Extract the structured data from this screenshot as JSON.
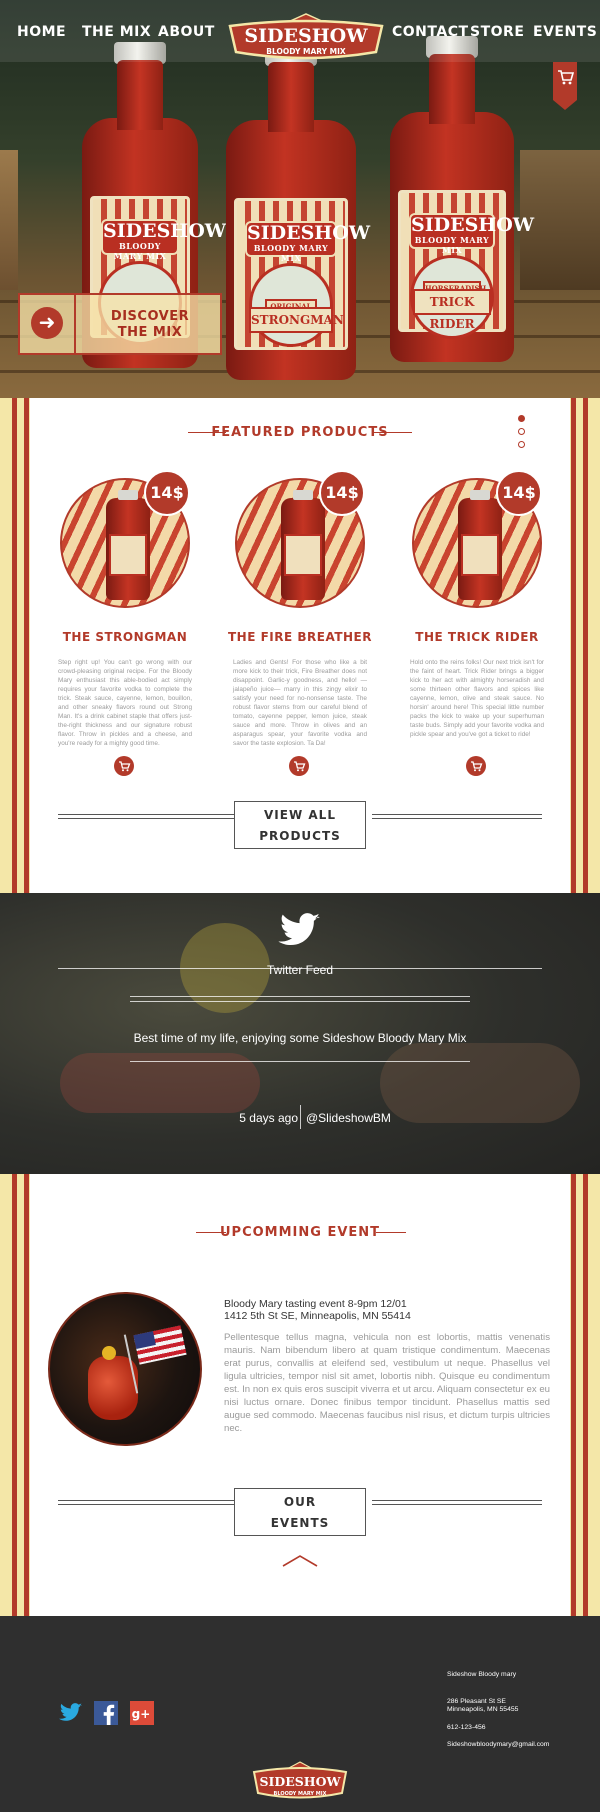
{
  "nav": {
    "home": "HOME",
    "mix": "THE MIX",
    "about": "ABOUT",
    "contact": "CONTACT",
    "store": "STORE",
    "events": "EVENTS"
  },
  "brand": {
    "name": "SIDESHOW",
    "tagline": "BLOODY MARY MIX"
  },
  "hero": {
    "bottles": [
      {
        "brand": "SIDESHOW",
        "tagline": "BLOODY MARY MIX",
        "plate": ""
      },
      {
        "brand": "SIDESHOW",
        "tagline": "BLOODY MARY MIX",
        "variant": "ORIGINAL",
        "plate": "STRONGMAN"
      },
      {
        "brand": "SIDESHOW",
        "tagline": "BLOODY MARY MIX",
        "variant": "HORSERADISH",
        "plate": "TRICK RIDER"
      }
    ],
    "discover_line1": "DISCOVER",
    "discover_line2": "THE MIX",
    "arrow_glyph": "➜"
  },
  "featured": {
    "title": "FEATURED PRODUCTS",
    "products": [
      {
        "price": "14$",
        "name": "THE STRONGMAN",
        "description": "Step right up! You can't go wrong with our crowd-pleasing original recipe. For the Bloody Mary enthusiast this able-bodied act simply requires your favorite vodka to complete the trick. Steak sauce, cayenne, lemon, bouillon, and other sneaky flavors round out Strong Man. It's a drink cabinet staple that offers just-the-right thickness and our signature robust flavor. Throw in pickles and a cheese, and you're ready for a mighty good time."
      },
      {
        "price": "14$",
        "name": "THE FIRE BREATHER",
        "description": "Ladies and Gents! For those who like a bit more kick to their trick, Fire Breather does not disappoint. Garlic-y goodness, and hello! —jalapeño juice— marry in this zingy elixir to satisfy your need for no-nonsense taste. The robust flavor stems from our careful blend of tomato, cayenne pepper, lemon juice, steak sauce and more. Throw in olives and an asparagus spear, your favorite vodka and savor the taste explosion. Ta Da!"
      },
      {
        "price": "14$",
        "name": "THE TRICK RIDER",
        "description": "Hold onto the reins folks! Our next trick isn't for the faint of heart. Trick Rider brings a bigger kick to her act with almighty horseradish and some thirteen other flavors and spices like cayenne, lemon, olive and steak sauce. No horsin' around here! This special little number packs the kick to wake up your superhuman taste buds. Simply add your favorite vodka and pickle spear and you've got a ticket to ride!"
      }
    ],
    "view_all_line1": "VIEW ALL",
    "view_all_line2": "PRODUCTS",
    "cart_glyph": "🛒"
  },
  "twitter": {
    "heading": "Twitter Feed",
    "tweet": "Best time of my life, enjoying some Sideshow Bloody Mary Mix",
    "time": "5 days ago",
    "handle": "@SlideshowBM"
  },
  "event": {
    "title": "UPCOMMING EVENT",
    "name": "Bloody Mary tasting event 8-9pm 12/01",
    "address": "1412 5th St SE, Minneapolis, MN 55414",
    "body": "Pellentesque tellus magna, vehicula non est lobortis, mattis venenatis mauris. Nam bibendum libero at quam tristique condimentum. Maecenas erat purus, convallis at eleifend sed, vestibulum ut neque. Phasellus vel ligula ultricies, tempor nisl sit amet, lobortis nibh. Quisque eu condimentum est. In non ex quis eros suscipit viverra et ut arcu. Aliquam consectetur ex eu nisi luctus ornare. Donec finibus tempor tincidunt. Phasellus mattis sed augue sed commodo. Maecenas faucibus nisl risus, et dictum turpis ultricies nec.",
    "button_line1": "OUR",
    "button_line2": "EVENTS"
  },
  "footer": {
    "company": "Sideshow Bloody mary",
    "street": "286 Pleasant St SE",
    "city": "Minneapolis, MN 55455",
    "phone": "612-123-456",
    "email": "Sideshowbloodymary@gmail.com",
    "social": [
      "twitter-icon",
      "facebook-icon",
      "google-plus-icon"
    ]
  },
  "colors": {
    "brand_red": "#b23a2a",
    "cream": "#f4e7a8",
    "footer": "#2f2f2f",
    "twitter_blue": "#2aa9e0",
    "facebook_blue": "#3b5998",
    "google_red": "#dd4b39"
  }
}
